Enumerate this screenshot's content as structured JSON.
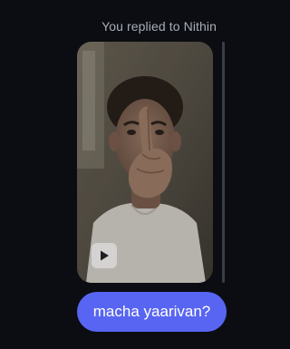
{
  "reply": {
    "label": "You replied to Nithin"
  },
  "media": {
    "type": "video",
    "play_icon": "play-icon"
  },
  "message": {
    "text": "macha yaarivan?"
  },
  "colors": {
    "background": "#0b0d12",
    "bubble": "#5865f2",
    "reply_label": "#a8adb6"
  }
}
